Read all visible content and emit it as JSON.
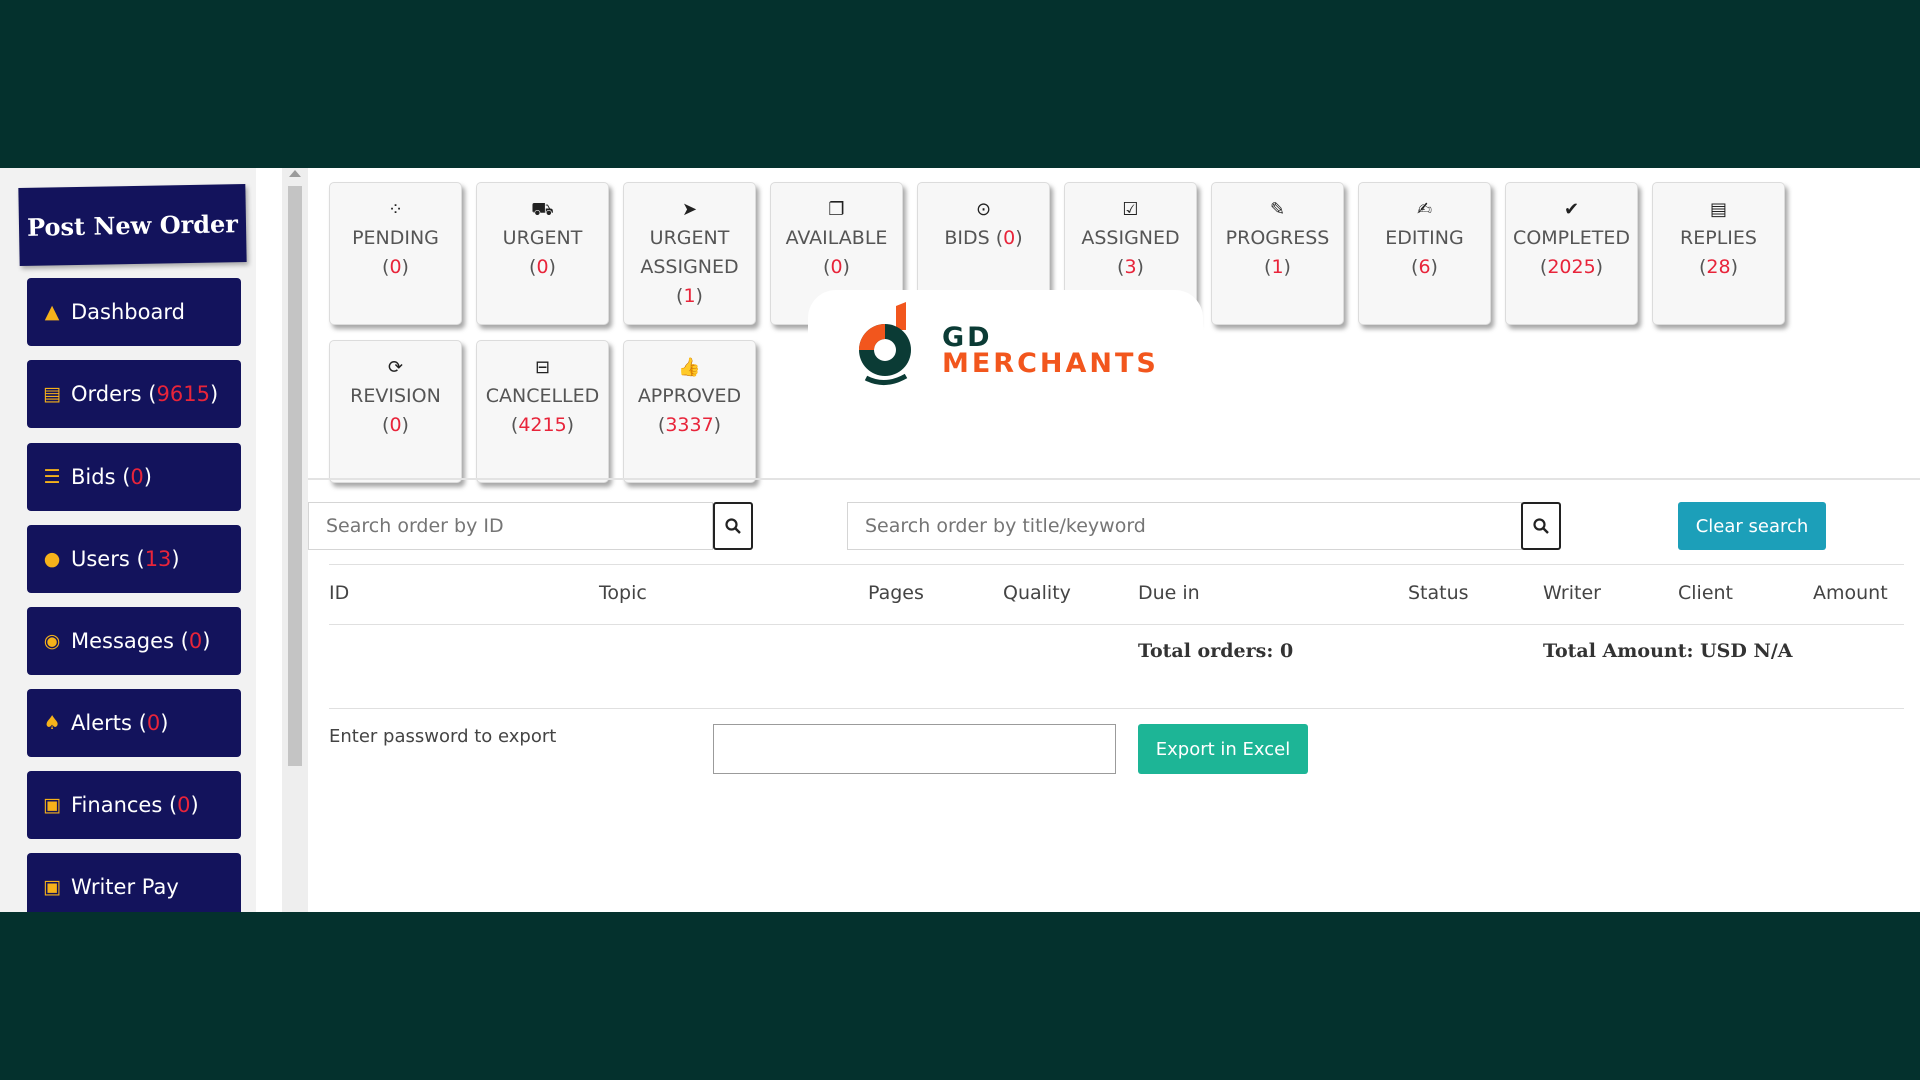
{
  "sidebar": {
    "post_new_order": "Post New Order",
    "items": [
      {
        "label": "Dashboard",
        "count": null,
        "icon": "area-chart-icon"
      },
      {
        "label": "Orders",
        "count": "9615",
        "icon": "file-icon"
      },
      {
        "label": "Bids",
        "count": "0",
        "icon": "list-icon"
      },
      {
        "label": "Users",
        "count": "13",
        "icon": "users-icon"
      },
      {
        "label": "Messages",
        "count": "0",
        "icon": "comments-icon"
      },
      {
        "label": "Alerts",
        "count": "0",
        "icon": "bell-icon"
      },
      {
        "label": "Finances",
        "count": "0",
        "icon": "money-icon"
      },
      {
        "label": "Writer Pay",
        "count": null,
        "icon": "user-badge-icon"
      }
    ]
  },
  "tiles": [
    {
      "label": "PENDING",
      "count": "0",
      "icon": "spinner-icon"
    },
    {
      "label": "URGENT",
      "count": "0",
      "icon": "ambulance-icon"
    },
    {
      "label": "URGENT ASSIGNED",
      "count": "1",
      "icon": "rocket-icon"
    },
    {
      "label": "AVAILABLE",
      "count": "0",
      "icon": "copy-icon"
    },
    {
      "label": "BIDS",
      "count": "0",
      "icon": "dot-circle-icon"
    },
    {
      "label": "ASSIGNED",
      "count": "3",
      "icon": "check-square-icon"
    },
    {
      "label": "PROGRESS",
      "count": "1",
      "icon": "pen-icon"
    },
    {
      "label": "EDITING",
      "count": "6",
      "icon": "edit-icon"
    },
    {
      "label": "COMPLETED",
      "count": "2025",
      "icon": "check-icon"
    },
    {
      "label": "REPLIES",
      "count": "28",
      "icon": "file-text-icon"
    },
    {
      "label": "REVISION",
      "count": "0",
      "icon": "refresh-icon"
    },
    {
      "label": "CANCELLED",
      "count": "4215",
      "icon": "minus-square-icon"
    },
    {
      "label": "APPROVED",
      "count": "3337",
      "icon": "thumbs-up-icon"
    }
  ],
  "logo": {
    "line1": "GD",
    "line2": "MERCHANTS",
    "colors": {
      "dark": "#0b3b35",
      "orange": "#f2561d"
    }
  },
  "search": {
    "id_placeholder": "Search order by ID",
    "keyword_placeholder": "Search order by title/keyword",
    "clear_label": "Clear search"
  },
  "table": {
    "headers": [
      "ID",
      "Topic",
      "Pages",
      "Quality",
      "Due in",
      "Status",
      "Writer",
      "Client",
      "Amount"
    ],
    "total_orders": "Total orders: 0",
    "total_amount": "Total Amount: USD N/A"
  },
  "export": {
    "label": "Enter password to export",
    "button": "Export in Excel"
  },
  "colors": {
    "background": "#04312d",
    "sidebar_button": "#13135c",
    "count_red": "#e8243a",
    "clear_button": "#1c9fb9",
    "export_button": "#1db596"
  }
}
